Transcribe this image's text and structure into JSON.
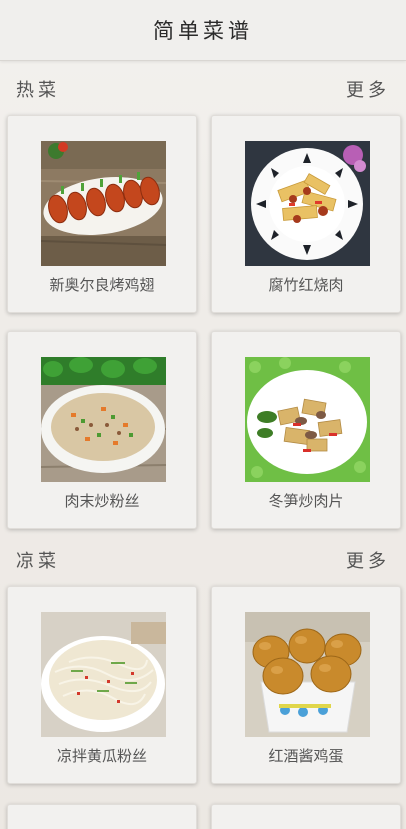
{
  "app": {
    "title": "简单菜谱"
  },
  "sections": [
    {
      "label": "热菜",
      "more": "更多",
      "items": [
        {
          "name": "新奥尔良烤鸡翅",
          "image": "grilled-chicken-wings-photo"
        },
        {
          "name": "腐竹红烧肉",
          "image": "braised-pork-tofu-skin-photo"
        },
        {
          "name": "肉末炒粉丝",
          "image": "minced-pork-vermicelli-photo"
        },
        {
          "name": "冬笋炒肉片",
          "image": "bamboo-shoot-pork-photo"
        }
      ]
    },
    {
      "label": "凉菜",
      "more": "更多",
      "items": [
        {
          "name": "凉拌黄瓜粉丝",
          "image": "cucumber-vermicelli-salad-photo"
        },
        {
          "name": "红酒酱鸡蛋",
          "image": "red-wine-braised-eggs-photo"
        }
      ]
    }
  ]
}
